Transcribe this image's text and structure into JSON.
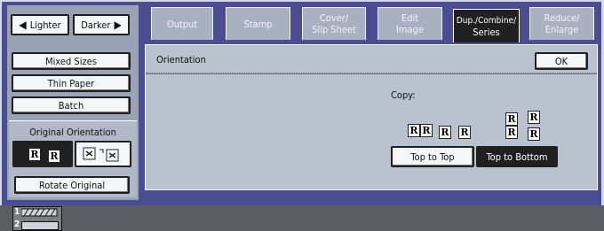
{
  "density": {
    "lighter": "Lighter",
    "darker": "Darker"
  },
  "left_buttons": [
    "Mixed Sizes",
    "Thin Paper",
    "Batch"
  ],
  "original_orientation": {
    "label": "Original Orientation",
    "rotate_label": "Rotate Original"
  },
  "tabs": [
    {
      "line1": "Output",
      "line2": ""
    },
    {
      "line1": "Stamp",
      "line2": ""
    },
    {
      "line1": "Cover/",
      "line2": "Slip Sheet"
    },
    {
      "line1": "Edit",
      "line2": "Image"
    },
    {
      "line1": "Dup./Combine/",
      "line2": "Series"
    },
    {
      "line1": "Reduce/",
      "line2": "Enlarge"
    }
  ],
  "panel": {
    "title": "Orientation",
    "ok": "OK",
    "copy_label": "Copy:",
    "options": [
      "Top to Top",
      "Top to Bottom"
    ],
    "selected_option": "Top to Bottom"
  },
  "orientation_glyph": "R",
  "footer": {
    "row1": "1",
    "row2": "2"
  },
  "colors": {
    "selected_bg": "#202020",
    "panel_bg": "#4a4d8f",
    "footer_bg": "#5b5d62"
  }
}
